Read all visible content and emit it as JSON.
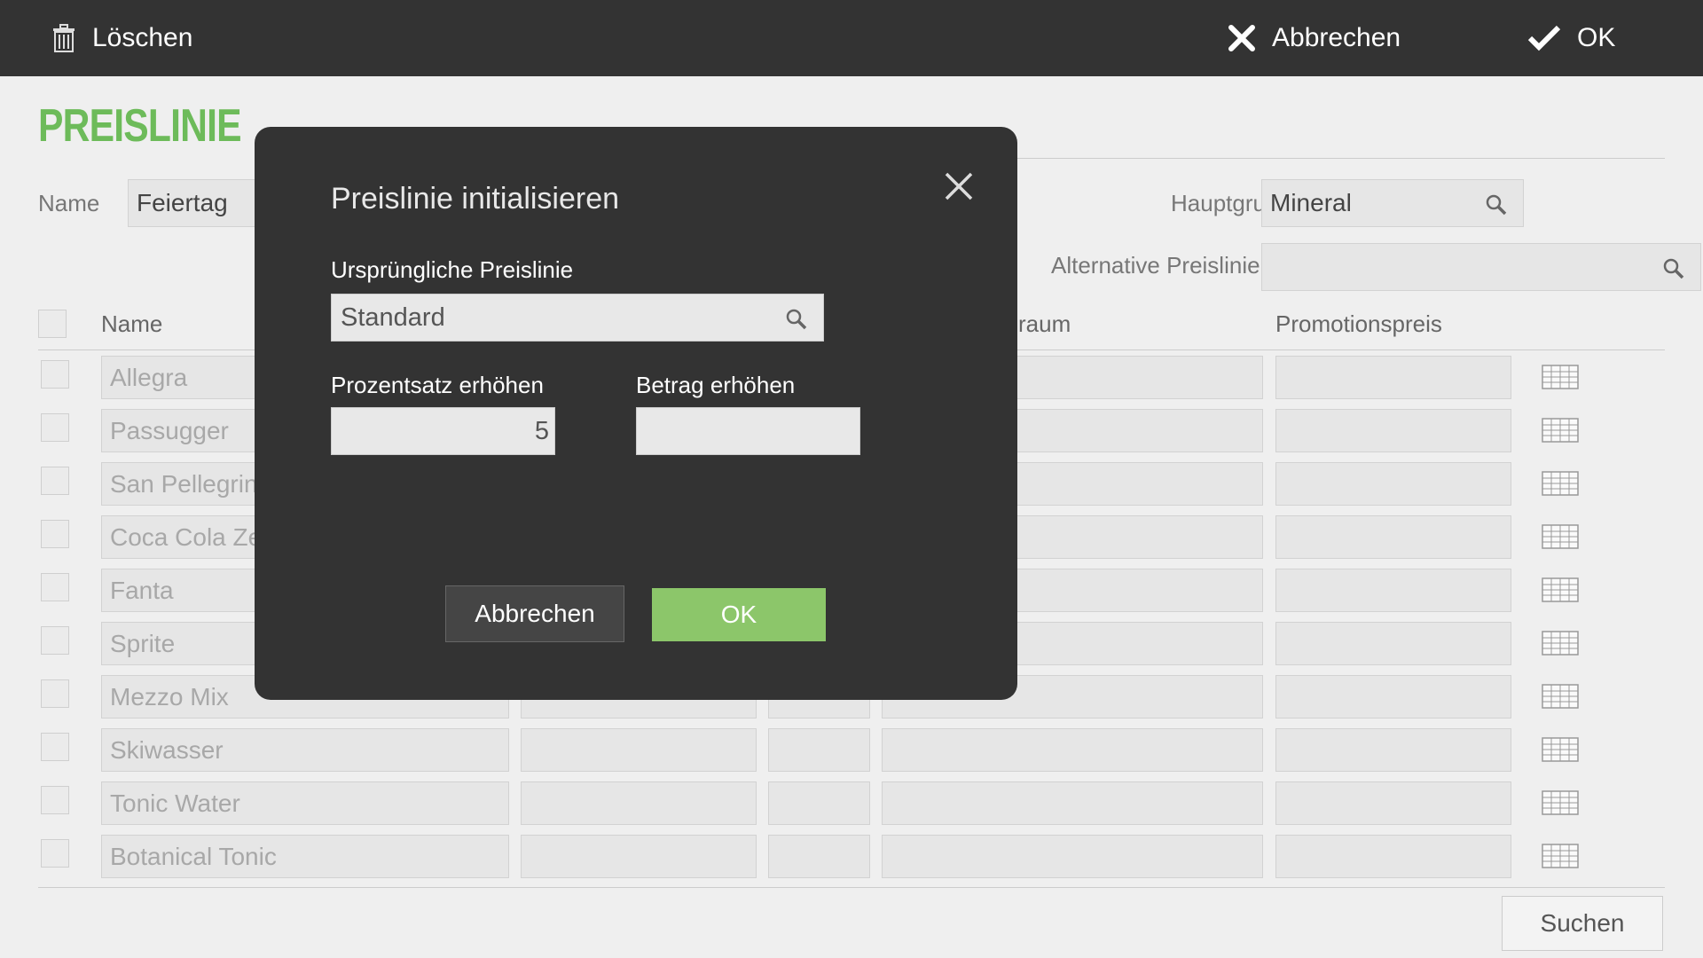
{
  "toolbar": {
    "delete_label": "Löschen",
    "cancel_label": "Abbrechen",
    "ok_label": "OK"
  },
  "page": {
    "title": "PREISLINIE",
    "name_label": "Name",
    "name_value": "Feiertag",
    "hauptgruppe_label": "Hauptgru",
    "hauptgruppe_value": "Mineral",
    "alt_preislinie_label": "Alternative Preislinie",
    "alt_preislinie_value": ""
  },
  "table": {
    "columns": [
      "Name",
      "raum",
      "Promotionspreis"
    ],
    "rows": [
      {
        "name": "Allegra"
      },
      {
        "name": "Passugger"
      },
      {
        "name": "San Pellegrino"
      },
      {
        "name": "Coca Cola Zero"
      },
      {
        "name": "Fanta"
      },
      {
        "name": "Sprite"
      },
      {
        "name": "Mezzo Mix"
      },
      {
        "name": "Skiwasser"
      },
      {
        "name": "Tonic Water"
      },
      {
        "name": "Botanical Tonic"
      }
    ]
  },
  "search_button": "Suchen",
  "dialog": {
    "title": "Preislinie initialisieren",
    "source_label": "Ursprüngliche Preislinie",
    "source_value": "Standard",
    "percent_label": "Prozentsatz erhöhen",
    "percent_value": "5",
    "amount_label": "Betrag erhöhen",
    "amount_value": "",
    "cancel_label": "Abbrechen",
    "ok_label": "OK"
  },
  "colors": {
    "topbar": "#333333",
    "accent_green": "#6dbb5a",
    "ok_green": "#8cc66a",
    "dialog_bg": "#333333"
  }
}
